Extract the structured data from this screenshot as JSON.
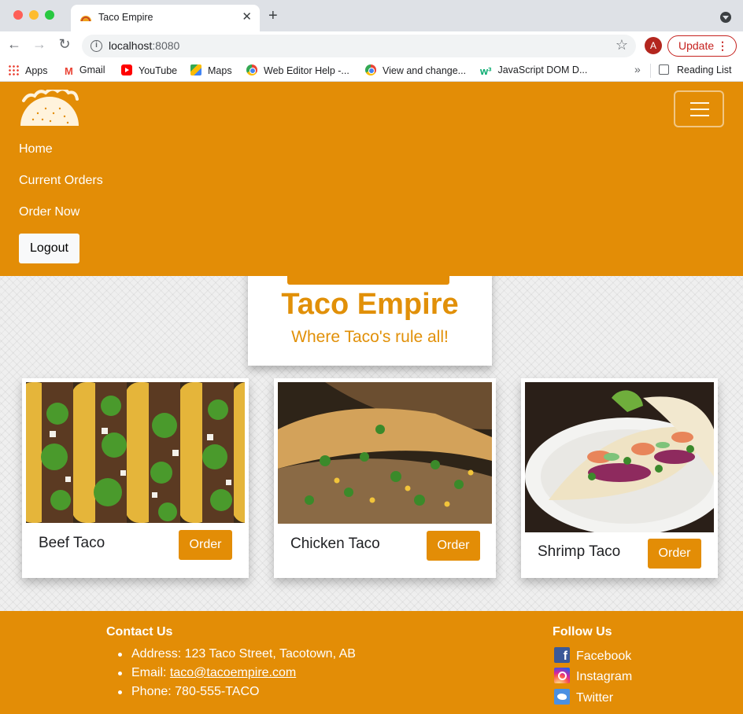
{
  "browser": {
    "tab_title": "Taco Empire",
    "url_host": "localhost",
    "url_port": ":8080",
    "avatar_letter": "A",
    "update_label": "Update",
    "bookmarks": [
      "Apps",
      "Gmail",
      "YouTube",
      "Maps",
      "Web Editor Help -...",
      "View and change...",
      "JavaScript DOM D..."
    ],
    "reading_list": "Reading List"
  },
  "nav": {
    "links": [
      "Home",
      "Current Orders",
      "Order Now"
    ],
    "logout_label": "Logout"
  },
  "hero": {
    "title": "Taco Empire",
    "tagline": "Where Taco's rule all!"
  },
  "products": [
    {
      "name": "Beef Taco",
      "button": "Order"
    },
    {
      "name": "Chicken Taco",
      "button": "Order"
    },
    {
      "name": "Shrimp Taco",
      "button": "Order"
    }
  ],
  "footer": {
    "contact_heading": "Contact Us",
    "address": "Address: 123 Taco Street, Tacotown, AB",
    "email_label": "Email: ",
    "email": "taco@tacoempire.com",
    "phone": "Phone: 780-555-TACO",
    "follow_heading": "Follow Us",
    "social": [
      "Facebook",
      "Instagram",
      "Twitter"
    ]
  },
  "colors": {
    "brand_orange": "#e38d06",
    "hero_text": "#e19008"
  }
}
